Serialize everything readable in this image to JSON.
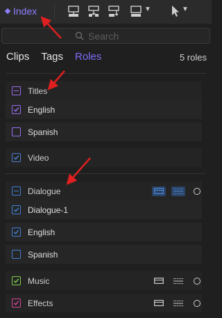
{
  "toolbar": {
    "index_label": "Index"
  },
  "search": {
    "placeholder": "Search"
  },
  "tabs": [
    "Clips",
    "Tags",
    "Roles"
  ],
  "active_tab": "Roles",
  "roles_count": "5 roles",
  "colors": {
    "accent": "#7b6cf6",
    "titles": "#9b6cf0",
    "video": "#4a7fd0",
    "dialogue": "#3f7fd4",
    "music": "#7ed14a",
    "effects": "#d8459a"
  },
  "roles": {
    "titles": {
      "label": "Titles",
      "children": [
        "English",
        "Spanish"
      ]
    },
    "video": {
      "label": "Video"
    },
    "dialogue": {
      "label": "Dialogue",
      "children": [
        "Dialogue-1",
        "English",
        "Spanish"
      ]
    },
    "music": {
      "label": "Music"
    },
    "effects": {
      "label": "Effects"
    }
  }
}
